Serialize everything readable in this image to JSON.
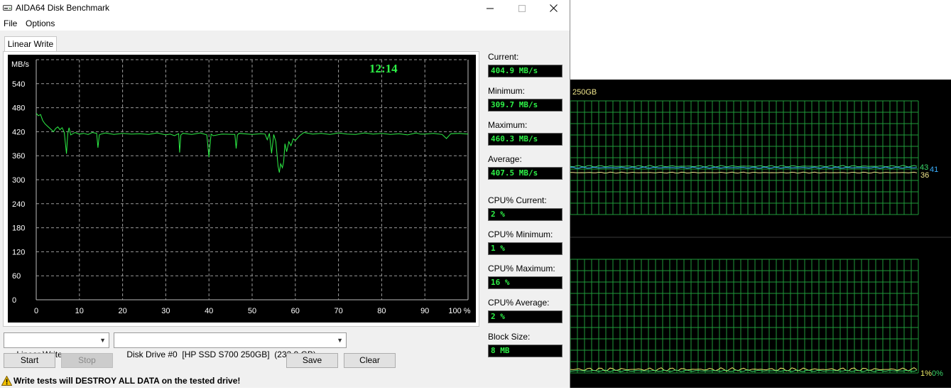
{
  "window": {
    "title": "AIDA64 Disk Benchmark",
    "menu": [
      "File",
      "Options"
    ],
    "tab_label": "Linear Write"
  },
  "graph": {
    "timer": "12:14",
    "y_unit": "MB/s",
    "y_ticks": [
      "540",
      "480",
      "420",
      "360",
      "300",
      "240",
      "180",
      "120",
      "60",
      "0"
    ],
    "x_ticks": [
      "0",
      "10",
      "20",
      "30",
      "40",
      "50",
      "60",
      "70",
      "80",
      "90",
      "100 %"
    ]
  },
  "chart_data": {
    "type": "line",
    "title": "",
    "xlabel": "%",
    "ylabel": "MB/s",
    "xlim": [
      0,
      100
    ],
    "ylim": [
      0,
      600
    ],
    "grid": true,
    "series": [
      {
        "color": "#2df046",
        "x": [
          0,
          0.5,
          1,
          1.5,
          2,
          2.5,
          3,
          3.5,
          4,
          4.5,
          5,
          5.5,
          6,
          6.5,
          7,
          7.3,
          7.6,
          8,
          9,
          10,
          11,
          12,
          13,
          14,
          14.3,
          14.6,
          15,
          16,
          18,
          20,
          22,
          24,
          26,
          28,
          30,
          31,
          32,
          33,
          33.2,
          33.5,
          34,
          36,
          38,
          39.5,
          40,
          40.5,
          41,
          43,
          46,
          46.3,
          46.6,
          47,
          50,
          52,
          53,
          53.5,
          54,
          54.5,
          55,
          55.5,
          56,
          56.3,
          56.6,
          57,
          57.3,
          57.6,
          58,
          58.5,
          59,
          59.5,
          60,
          61,
          62,
          64,
          66,
          68,
          70,
          72,
          74,
          76,
          78,
          80,
          82,
          84,
          86,
          88,
          89,
          90,
          92,
          94,
          95,
          96,
          98,
          100
        ],
        "y": [
          466,
          460,
          463,
          448,
          440,
          435,
          430,
          425,
          420,
          428,
          432,
          425,
          430,
          418,
          365,
          415,
          430,
          412,
          418,
          414,
          416,
          413,
          418,
          416,
          380,
          412,
          414,
          417,
          413,
          416,
          414,
          415,
          413,
          417,
          412,
          414,
          410,
          415,
          368,
          412,
          416,
          413,
          417,
          412,
          356,
          414,
          410,
          414,
          413,
          378,
          412,
          416,
          413,
          415,
          414,
          400,
          416,
          366,
          413,
          395,
          334,
          318,
          340,
          330,
          345,
          390,
          370,
          395,
          385,
          402,
          398,
          410,
          418,
          414,
          416,
          413,
          417,
          414,
          413,
          417,
          414,
          416,
          413,
          415,
          412,
          417,
          414,
          414,
          416,
          413,
          403,
          415,
          416,
          414
        ]
      }
    ]
  },
  "stats": {
    "current_label": "Current:",
    "current_value": "404.9 MB/s",
    "minimum_label": "Minimum:",
    "minimum_value": "309.7 MB/s",
    "maximum_label": "Maximum:",
    "maximum_value": "460.3 MB/s",
    "average_label": "Average:",
    "average_value": "407.5 MB/s",
    "cpu_current_label": "CPU% Current:",
    "cpu_current_value": "2 %",
    "cpu_minimum_label": "CPU% Minimum:",
    "cpu_minimum_value": "1 %",
    "cpu_maximum_label": "CPU% Maximum:",
    "cpu_maximum_value": "16 %",
    "cpu_average_label": "CPU% Average:",
    "cpu_average_value": "2 %",
    "block_size_label": "Block Size:",
    "block_size_value": "8 MB"
  },
  "controls": {
    "test_select": "Linear Write",
    "drive_select": "Disk Drive #0  [HP SSD S700 250GB]  (232.9 GB)",
    "start_label": "Start",
    "stop_label": "Stop",
    "save_label": "Save",
    "clear_label": "Clear"
  },
  "status": {
    "warning": "Write tests will DESTROY ALL DATA on the tested drive!"
  },
  "monitor": {
    "drive_label": "250GB",
    "temp_values": [
      "43",
      "41",
      "36"
    ],
    "temp_colors": [
      "#3ad86a",
      "#3ab0ff",
      "#f0e68c"
    ],
    "load_values": [
      "1%",
      "0%"
    ],
    "load_colors": [
      "#f0f06a",
      "#3ad86a"
    ],
    "grid_color": "#1f9a3a"
  }
}
